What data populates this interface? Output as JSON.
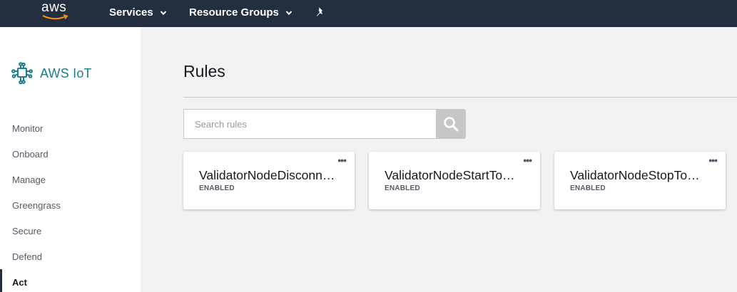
{
  "topbar": {
    "logo_text": "aws",
    "services_label": "Services",
    "resource_groups_label": "Resource Groups"
  },
  "sidebar": {
    "brand": "AWS IoT",
    "items": [
      {
        "label": "Monitor"
      },
      {
        "label": "Onboard"
      },
      {
        "label": "Manage"
      },
      {
        "label": "Greengrass"
      },
      {
        "label": "Secure"
      },
      {
        "label": "Defend"
      },
      {
        "label": "Act",
        "active": true
      }
    ]
  },
  "main": {
    "title": "Rules",
    "search": {
      "placeholder": "Search rules",
      "value": ""
    },
    "rules": [
      {
        "name": "ValidatorNodeDisconnected",
        "display": "ValidatorNodeDisconn…",
        "status": "ENABLED"
      },
      {
        "name": "ValidatorNodeStartToStop",
        "display": "ValidatorNodeStartTo…",
        "status": "ENABLED"
      },
      {
        "name": "ValidatorNodeStopToStart",
        "display": "ValidatorNodeStopTo…",
        "status": "ENABLED"
      }
    ],
    "card_menu_glyph": "•••"
  },
  "colors": {
    "navbar": "#232f3e",
    "brand_teal": "#1e7d8c",
    "background": "#f2f2f2"
  },
  "icons": [
    "aws-smile-icon",
    "chevron-down-icon",
    "pin-icon",
    "iot-brand-icon",
    "search-icon",
    "more-options-icon"
  ]
}
